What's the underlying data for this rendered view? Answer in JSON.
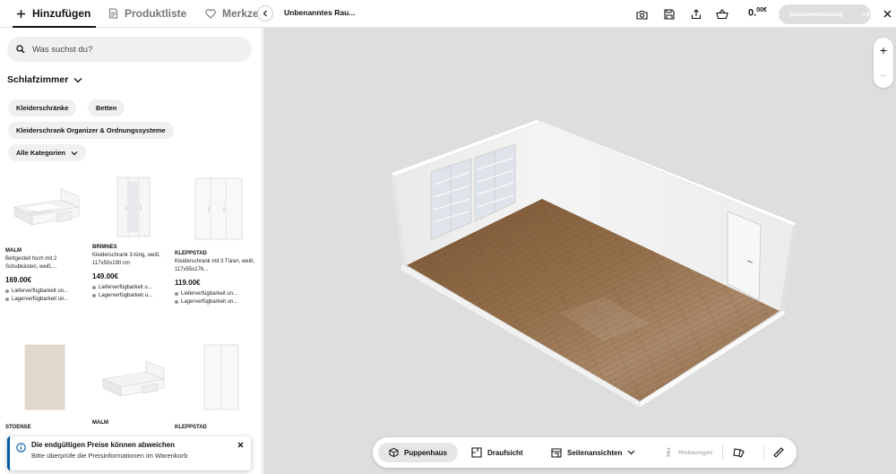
{
  "topbar": {
    "tabs": [
      {
        "label": "Hinzufügen",
        "icon": "plus-icon"
      },
      {
        "label": "Produktliste",
        "icon": "document-list-icon"
      },
      {
        "label": "Merkzett",
        "icon": "heart-icon"
      }
    ],
    "room_title": "Unbenanntes Rau...",
    "icons": [
      "camera-icon",
      "save-icon",
      "share-icon",
      "basket-icon"
    ],
    "price_main": "0.",
    "price_sup": "00€",
    "summary_label": "Zusammenfassung"
  },
  "sidebar": {
    "search_placeholder": "Was suchst du?",
    "category": "Schlafzimmer",
    "chips": [
      "Kleiderschränke",
      "Betten",
      "Kleiderschrank Organizer & Ordnungssysteme",
      "Alle Kategorien"
    ],
    "products": [
      {
        "name": "MALM",
        "desc": "Bettgestell hoch mit 2 Schubkästen, weiß,...",
        "price": "169.00€",
        "avail1": "Lieferverfügbarkeit un...",
        "avail2": "Lagerverfügbarkeit un..."
      },
      {
        "name": "BRIMNES",
        "desc": "Kleiderschrank 3-türig, weiß, 117x50x190 cm",
        "price": "149.00€",
        "avail1": "Lieferverfügbarkeit u...",
        "avail2": "Lagerverfügbarkeit u..."
      },
      {
        "name": "KLEPPSTAD",
        "desc": "Kleiderschrank mit 3 Türen, weiß, 117x55x176...",
        "price": "119.00€",
        "avail1": "Lieferverfügbarkeit un...",
        "avail2": "Lagerverfügbarkeit un..."
      },
      {
        "name": "STOENSE"
      },
      {
        "name": "MALM"
      },
      {
        "name": "KLEPPSTAD"
      }
    ],
    "toast": {
      "title": "Die endgültigen Preise können abweichen",
      "text": "Bitte überprüfe die Preisinformationen im Warenkorb"
    }
  },
  "canvas": {
    "zoom_in": "+",
    "zoom_out": "−",
    "toolbar": {
      "dollhouse": "Puppenhaus",
      "floorplan": "Draufsicht",
      "sideviews": "Seitenansichten",
      "move": "Hinbewegen"
    }
  },
  "colors": {
    "canvas_bg": "#dedede",
    "floor": "#8a6340",
    "wall": "#f4f4f4",
    "accent_info": "#0058a3"
  }
}
